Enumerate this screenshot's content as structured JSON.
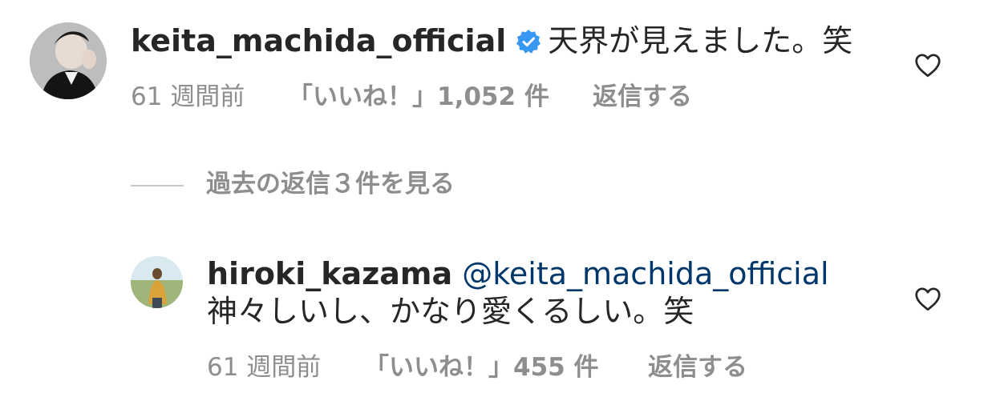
{
  "comments": [
    {
      "username": "keita_machida_official",
      "verified": true,
      "text": "天界が見えました。笑",
      "time": "61 週間前",
      "likes": "「いいね！」1,052 件",
      "reply": "返信する"
    }
  ],
  "view_replies": "過去の返信３件を見る",
  "replies": [
    {
      "username": "hiroki_kazama",
      "mention": "@keita_machida_official",
      "text": "神々しいし、かなり愛くるしい。笑",
      "time": "61 週間前",
      "likes": "「いいね！」455 件",
      "reply": "返信する"
    }
  ],
  "colors": {
    "text": "#262626",
    "secondary": "#8e8e8e",
    "mention": "#00376b",
    "verified": "#3897f0"
  }
}
